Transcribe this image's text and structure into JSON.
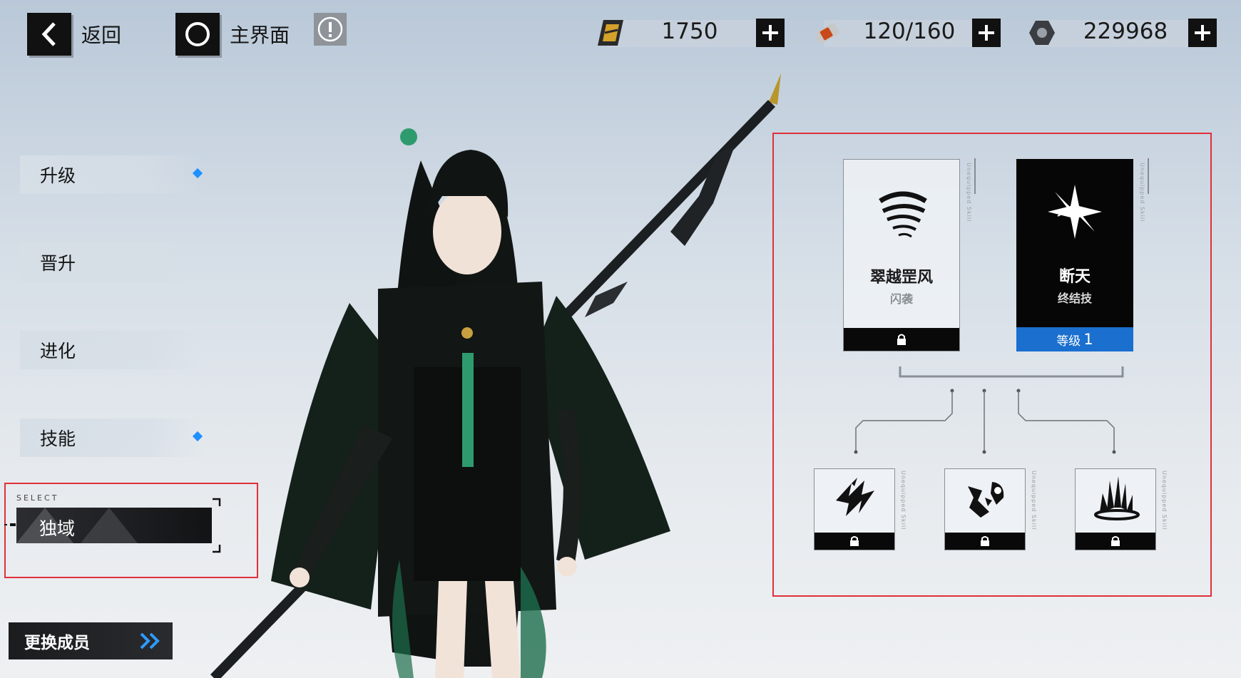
{
  "topbar": {
    "back_label": "返回",
    "home_label": "主界面",
    "info_icon": "exclamation-circle-icon"
  },
  "currencies": [
    {
      "icon": "gold-ticket-icon",
      "value": "1750"
    },
    {
      "icon": "battery-icon",
      "value": "120/160"
    },
    {
      "icon": "hex-nut-icon",
      "value": "229968"
    }
  ],
  "sidebar": {
    "items": [
      {
        "label": "升级",
        "has_dot": true
      },
      {
        "label": "晋升",
        "has_dot": false
      },
      {
        "label": "进化",
        "has_dot": false
      },
      {
        "label": "技能",
        "has_dot": true
      }
    ],
    "select_caption": "SELECT",
    "selected_label": "独域",
    "swap_label": "更换成员"
  },
  "skills": {
    "main": [
      {
        "name": "翠越罡风",
        "type": "闪袭",
        "icon": "whirlwind-icon",
        "locked": true,
        "side_text": "Unequipped Skill"
      },
      {
        "name": "断天",
        "type": "终结技",
        "icon": "starburst-icon",
        "locked": false,
        "level_label": "等级",
        "level_value": "1",
        "side_text": "Unequipped Skill"
      }
    ],
    "sub": [
      {
        "icon": "lightning-fist-icon",
        "locked": true,
        "side_text": "Unequipped Skill"
      },
      {
        "icon": "shatter-fist-icon",
        "locked": true,
        "side_text": "Unequipped Skill"
      },
      {
        "icon": "ground-spikes-icon",
        "locked": true,
        "side_text": "Unequipped Skill"
      }
    ]
  },
  "colors": {
    "accent_blue": "#1a6fcf",
    "highlight_red": "#e0303a",
    "dark": "#111111"
  }
}
